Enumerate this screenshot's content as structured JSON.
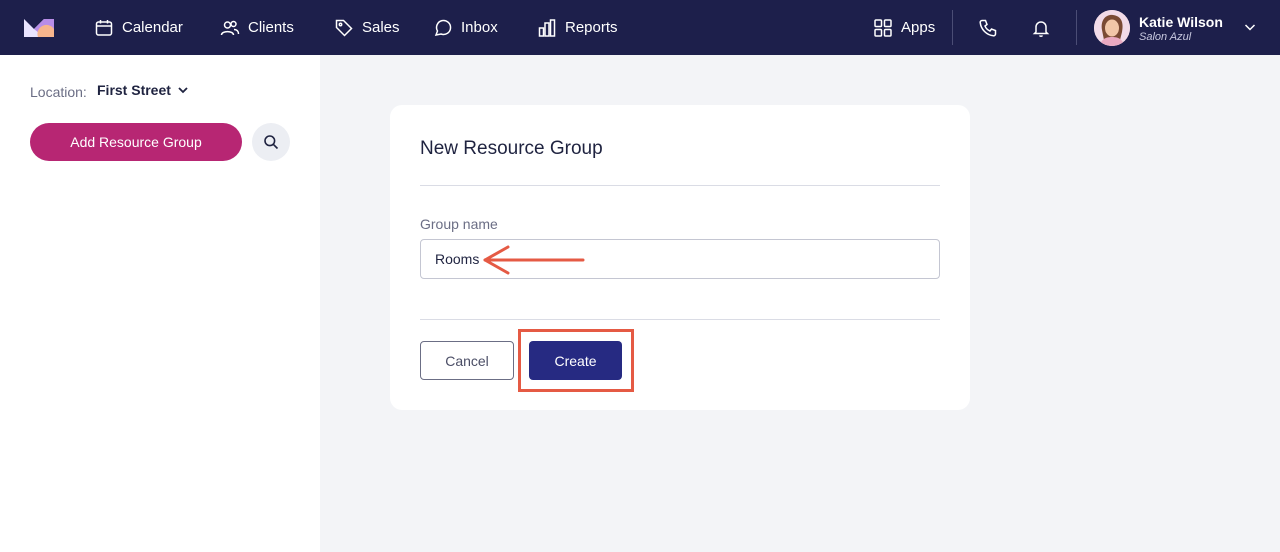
{
  "nav": {
    "items": [
      {
        "label": "Calendar",
        "icon": "calendar-icon"
      },
      {
        "label": "Clients",
        "icon": "users-icon"
      },
      {
        "label": "Sales",
        "icon": "tag-icon"
      },
      {
        "label": "Inbox",
        "icon": "chat-icon"
      },
      {
        "label": "Reports",
        "icon": "bar-chart-icon"
      }
    ],
    "apps_label": "Apps",
    "user": {
      "name": "Katie Wilson",
      "org": "Salon Azul"
    }
  },
  "sidebar": {
    "location_label": "Location:",
    "location_value": "First Street",
    "add_button_label": "Add Resource Group"
  },
  "card": {
    "title": "New Resource Group",
    "field_label": "Group name",
    "field_value": "Rooms",
    "cancel_label": "Cancel",
    "create_label": "Create"
  },
  "colors": {
    "nav_bg": "#1d1f4b",
    "accent_magenta": "#b72673",
    "primary_button": "#262a82",
    "annotation_red": "#e55a44"
  }
}
